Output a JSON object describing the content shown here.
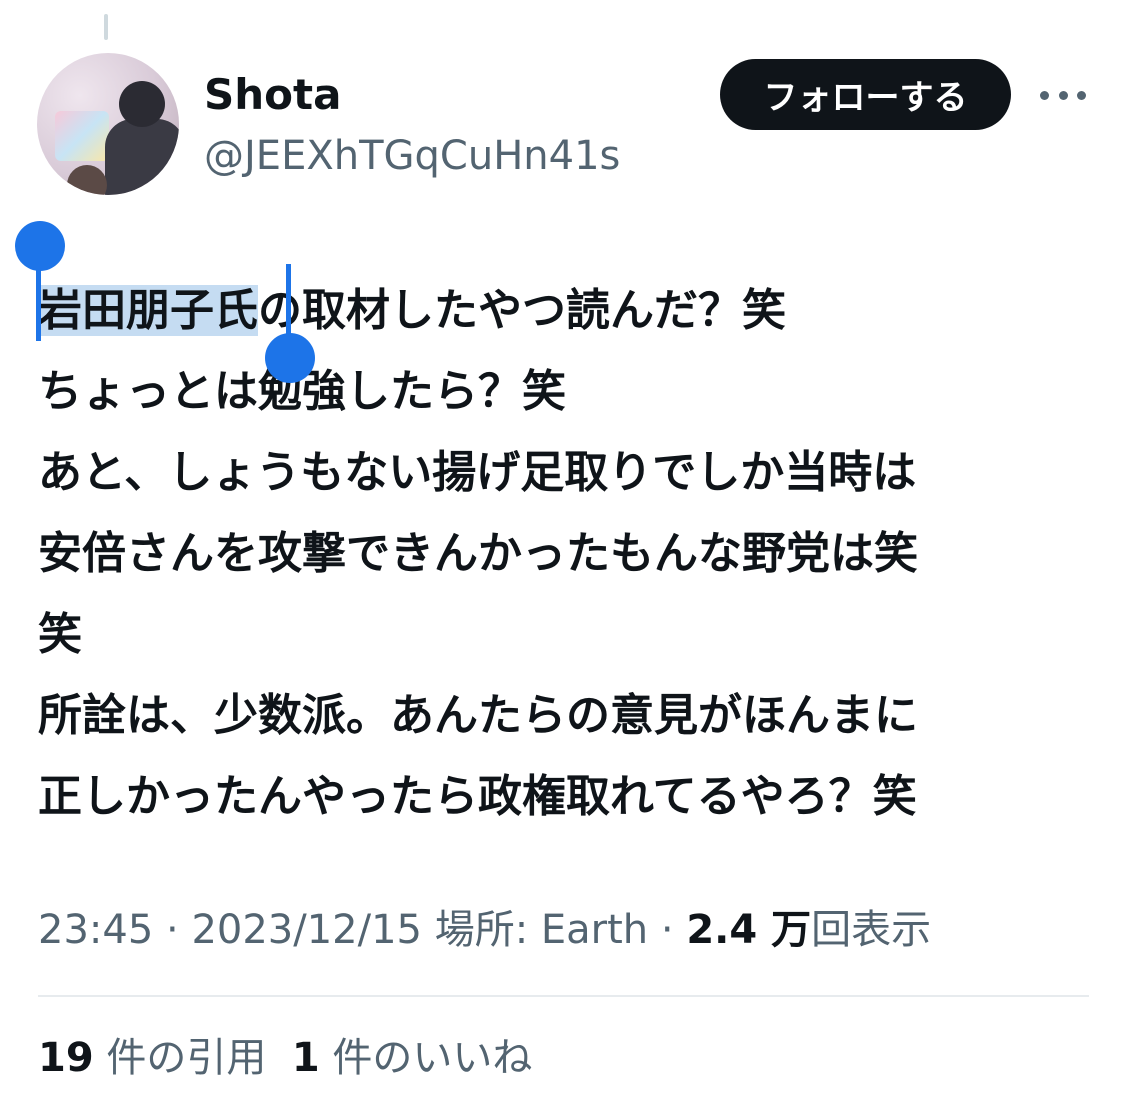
{
  "author": {
    "display_name": "Shota",
    "handle": "@JEEXhTGqCuHn41s"
  },
  "follow_button_label": "フォローする",
  "more_icon": "more-horizontal-icon",
  "tweet": {
    "selected_text": "岩田朋子氏",
    "lines": [
      "の取材したやつ読んだ？笑",
      "ちょっとは勉強したら？笑",
      "あと、しょうもない揚げ足取りでしか当時は",
      "安倍さんを攻撃できんかったもんな野党は笑",
      "笑",
      "所詮は、少数派。あんたらの意見がほんまに",
      "正しかったんやったら政権取れてるやろ？笑"
    ]
  },
  "meta": {
    "time": "23:45",
    "date": "2023/12/15",
    "location": "場所: Earth",
    "views_count": "2.4 万",
    "views_label": "回表示",
    "separator": " · "
  },
  "stats": {
    "quotes_count": "19",
    "quotes_label": "件の引用",
    "likes_count": "1",
    "likes_label": "件のいいね"
  },
  "colors": {
    "text": "#0f1419",
    "secondary": "#536471",
    "selection": "#c5dcf2",
    "selection_handle": "#1d74e8",
    "follow_bg": "#0f1419"
  }
}
